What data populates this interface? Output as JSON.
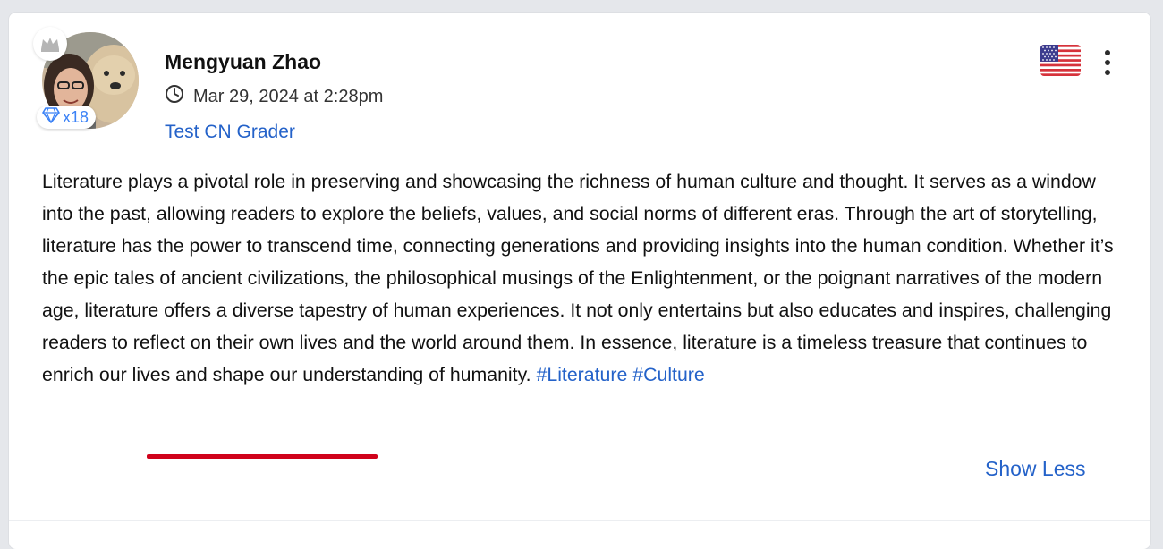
{
  "post": {
    "author_name": "Mengyuan Zhao",
    "timestamp": "Mar 29, 2024 at 2:28pm",
    "group_name": "Test CN Grader",
    "gem_count": "x18",
    "body_text": "Literature plays a pivotal role in preserving and showcasing the richness of human culture and thought. It serves as a window into the past, allowing readers to explore the beliefs, values, and social norms of different eras. Through the art of storytelling, literature has the power to transcend time, connecting generations and providing insights into the human condition. Whether it’s the epic tales of ancient civilizations, the philosophical musings of the Enlightenment, or the poignant narratives of the modern age, literature offers a diverse tapestry of human experiences. It not only entertains but also educates and inspires, challenging readers to reflect on their own lives and the world around them. In essence, literature is a timeless treasure that continues to enrich our lives and shape our understanding of humanity.",
    "hashtags": [
      "#Literature",
      "#Culture"
    ],
    "show_less_label": "Show Less",
    "flag": "us-flag-icon"
  },
  "colors": {
    "link": "#2462c9",
    "highlight_underline": "#d0021b",
    "gem": "#3b82f6"
  }
}
